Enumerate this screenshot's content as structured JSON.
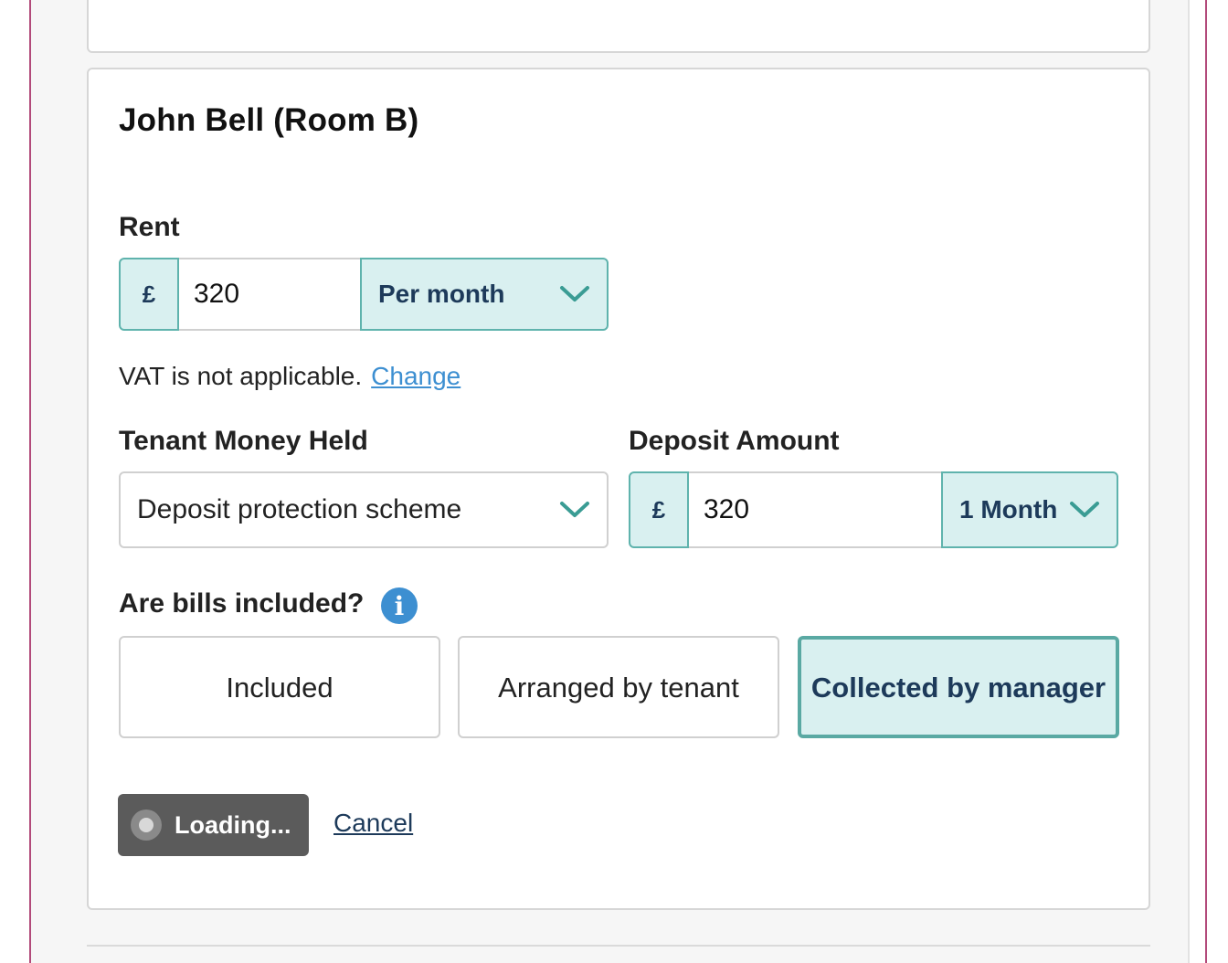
{
  "tenant": {
    "title": "John Bell (Room B)"
  },
  "rent": {
    "label": "Rent",
    "currency": "£",
    "amount": "320",
    "period": "Per month"
  },
  "vat": {
    "text": "VAT is not applicable.",
    "change_link": "Change"
  },
  "tenant_money": {
    "label": "Tenant Money Held",
    "value": "Deposit protection scheme"
  },
  "deposit": {
    "label": "Deposit Amount",
    "currency": "£",
    "amount": "320",
    "period": "1 Month"
  },
  "bills": {
    "label": "Are bills included?",
    "info_icon": "i",
    "options": [
      {
        "label": "Included",
        "selected": false
      },
      {
        "label": "Arranged by tenant",
        "selected": false
      },
      {
        "label": "Collected by manager",
        "selected": true
      }
    ]
  },
  "actions": {
    "submit_label": "Loading...",
    "cancel_label": "Cancel"
  },
  "colors": {
    "accent_bg": "#d9f0f0",
    "accent_border": "#5fb3ad",
    "link": "#3d8fd1",
    "frame": "#b24a7a"
  }
}
